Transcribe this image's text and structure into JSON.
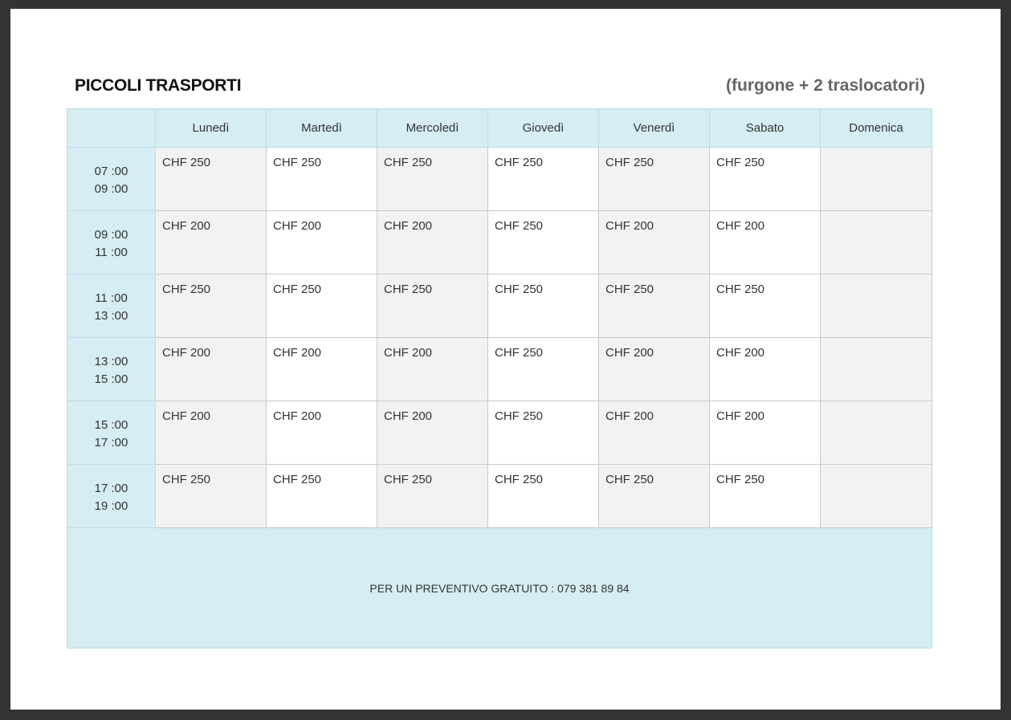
{
  "header": {
    "title": "PICCOLI TRASPORTI",
    "subtitle": "(furgone + 2 traslocatori)"
  },
  "table": {
    "days": [
      "Lunedì",
      "Martedì",
      "Mercoledì",
      "Giovedì",
      "Venerdì",
      "Sabato",
      "Domenica"
    ],
    "rows": [
      {
        "start": "07 :00",
        "end": "09 :00",
        "prices": [
          "CHF 250",
          "CHF 250",
          "CHF 250",
          "CHF 250",
          "CHF 250",
          "CHF 250",
          ""
        ]
      },
      {
        "start": "09 :00",
        "end": "11 :00",
        "prices": [
          "CHF 200",
          "CHF 200",
          "CHF 200",
          "CHF 250",
          "CHF 200",
          "CHF 200",
          ""
        ]
      },
      {
        "start": "11 :00",
        "end": "13 :00",
        "prices": [
          "CHF 250",
          "CHF 250",
          "CHF 250",
          "CHF 250",
          "CHF 250",
          "CHF 250",
          ""
        ]
      },
      {
        "start": "13 :00",
        "end": "15 :00",
        "prices": [
          "CHF 200",
          "CHF 200",
          "CHF 200",
          "CHF 250",
          "CHF 200",
          "CHF 200",
          ""
        ]
      },
      {
        "start": "15 :00",
        "end": "17 :00",
        "prices": [
          "CHF 200",
          "CHF 200",
          "CHF 200",
          "CHF 250",
          "CHF 200",
          "CHF 200",
          ""
        ]
      },
      {
        "start": "17 :00",
        "end": "19 :00",
        "prices": [
          "CHF 250",
          "CHF 250",
          "CHF 250",
          "CHF 250",
          "CHF 250",
          "CHF 250",
          ""
        ]
      }
    ],
    "footer": "PER UN PREVENTIVO GRATUITO : 079 381 89 84"
  },
  "colors": {
    "header_bg": "#d5edf3",
    "shade_bg": "#f2f2f2",
    "frame": "#333333"
  }
}
